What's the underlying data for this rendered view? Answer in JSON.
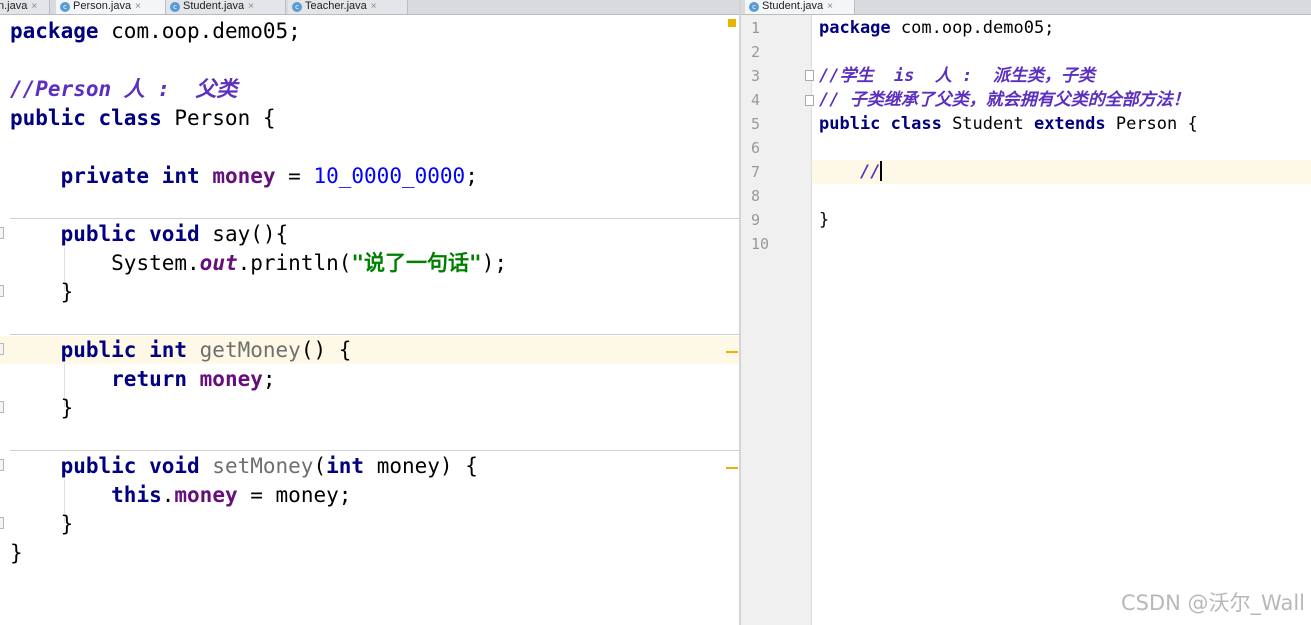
{
  "left_tabs": [
    {
      "label": "n.java",
      "active": false
    },
    {
      "label": "Person.java",
      "active": true
    },
    {
      "label": "Student.java",
      "active": false
    },
    {
      "label": "Teacher.java",
      "active": false
    }
  ],
  "right_tabs": [
    {
      "label": "Student.java",
      "active": true
    }
  ],
  "tab_close": "×",
  "class_icon": "c",
  "person_code": {
    "package_kw": "package",
    "package_name": " com.oop.demo05;",
    "comment": "//Person 人 :  父类",
    "class_decl_kw": "public class",
    "class_decl_rest": " Person {",
    "field_kw": "private int",
    "field_name": "money",
    "field_assign": " = ",
    "field_value": "10_0000_0000",
    "field_end": ";",
    "say_kw": "public void",
    "say_rest": " say(){",
    "println_obj": "System.",
    "println_static": "out",
    "println_call": ".println(",
    "println_str": "\"说了一句话\"",
    "println_end": ");",
    "close_brace": "}",
    "getter_kw": "public int",
    "getter_name": " getMoney",
    "getter_rest": "() {",
    "return_kw": "return",
    "return_field": " money",
    "return_end": ";",
    "setter_kw": "public void",
    "setter_name": " setMoney",
    "setter_paren": "(",
    "setter_param_kw": "int",
    "setter_param_rest": " money) {",
    "this_kw": "this",
    "this_dot": ".",
    "this_field": "money",
    "this_rest": " = money;",
    "class_close": "}"
  },
  "student_code": {
    "line_numbers": [
      "1",
      "2",
      "3",
      "4",
      "5",
      "6",
      "7",
      "8",
      "9",
      "10"
    ],
    "package_kw": "package",
    "package_name": " com.oop.demo05;",
    "comment1": "//学生  is  人 :  派生类，子类",
    "comment2": "// 子类继承了父类，就会拥有父类的全部方法！",
    "class_kw": "public class",
    "class_name": " Student ",
    "extends_kw": "extends",
    "class_rest": " Person {",
    "line7_comment": "//",
    "class_close": "}"
  },
  "watermark": "CSDN @沃尔_Wall",
  "colors": {
    "keyword": "#000080",
    "field": "#660e7a",
    "number": "#0000ff",
    "string": "#008000",
    "comment": "#5b2fbf",
    "current_line": "#fdf9e6",
    "marker": "#e8b400"
  }
}
